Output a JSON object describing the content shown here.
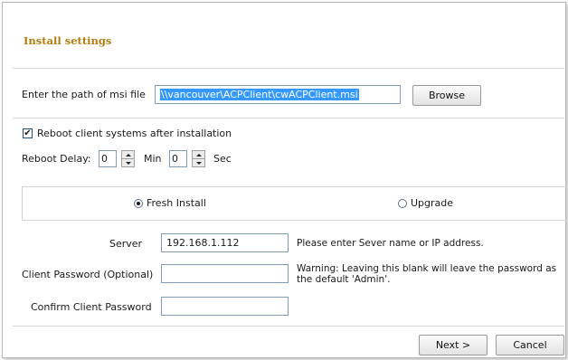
{
  "header": {
    "title": "Install settings"
  },
  "msi": {
    "label": "Enter the path of msi file",
    "path_value": "\\\\vancouver\\ACPClient\\cwACPClient.msi",
    "browse_label": "Browse"
  },
  "reboot": {
    "checkbox_label": "Reboot client systems after installation",
    "checked": true,
    "delay_label": "Reboot Delay:",
    "min_value": "0",
    "min_label": "Min",
    "sec_value": "0",
    "sec_label": "Sec"
  },
  "install_type": {
    "options": [
      {
        "label": "Fresh Install",
        "selected": true
      },
      {
        "label": "Upgrade",
        "selected": false
      }
    ]
  },
  "form": {
    "server_label": "Server",
    "server_value": "192.168.1.112",
    "server_hint": "Please enter Sever name or IP address.",
    "password_label": "Client Password (Optional)",
    "password_value": "",
    "password_warning": "Warning:  Leaving this blank will leave the password as the default 'Admin'.",
    "confirm_label": "Confirm Client Password",
    "confirm_value": ""
  },
  "footer": {
    "next_label": "Next >",
    "cancel_label": "Cancel"
  },
  "colors": {
    "title": "#b07d10",
    "selection": "#3399ff",
    "input_border": "#7f9db9"
  },
  "icons": {
    "checkbox": "checkmark-icon",
    "spin_up": "spin-up-arrow-icon",
    "spin_down": "spin-down-arrow-icon",
    "radio": "radio-dot-icon"
  }
}
